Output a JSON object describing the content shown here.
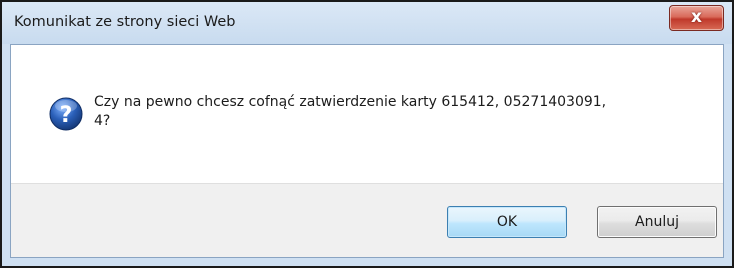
{
  "window": {
    "title": "Komunikat ze strony sieci Web",
    "close_label": "x"
  },
  "message": {
    "icon": "question-icon",
    "line1": "Czy na pewno chcesz cofnąć zatwierdzenie karty 615412, 05271403091,",
    "line2": "4?"
  },
  "buttons": {
    "ok_label": "OK",
    "cancel_label": "Anuluj"
  },
  "colors": {
    "frame": "#cfe0f2",
    "close_button": "#c0392b",
    "ok_border": "#3c7fb1",
    "icon_blue": "#2a5fb8"
  }
}
